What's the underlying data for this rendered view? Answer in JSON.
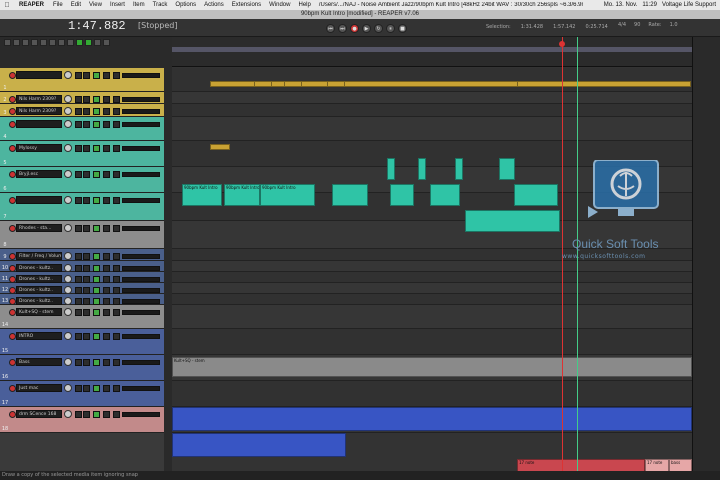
{
  "menubar": {
    "apple": "",
    "app": "REAPER",
    "items": [
      "File",
      "Edit",
      "View",
      "Insert",
      "Item",
      "Track",
      "Options",
      "Actions",
      "Extensions",
      "Window",
      "Help"
    ],
    "project_path": "/Users/.../NAJ - Noise Ambient Jazz/90bpm Kult Intro [48kHz 24bit WAV : 30/30ch 256spls ~6.3/6.9ms]",
    "date": "Mo. 13. Nov.",
    "time": "11:29",
    "user": "Voltage Life Support"
  },
  "window": {
    "title": "90bpm Kult Intro [modified] - REAPER v7.06"
  },
  "transport": {
    "position": "1:47.882",
    "state": "[Stopped]",
    "buttons": [
      "⏮",
      "⏭",
      "●",
      "▶",
      "↻",
      "⏸",
      "■"
    ],
    "selection_label": "Selection:",
    "sel_start": "1:31.428",
    "sel_end": "1:57.142",
    "sel_len": "0:25.714",
    "time_sig": "4/4",
    "bpm": "90",
    "rate_label": "Rate:",
    "rate": "1.0"
  },
  "tracks": [
    {
      "num": "1",
      "name": "",
      "color": "#c9b04a",
      "h": 24
    },
    {
      "num": "2",
      "name": "Nils Harm 2309?",
      "color": "#c9b04a",
      "h": 12
    },
    {
      "num": "3",
      "name": "Nils Harm 2309?",
      "color": "#c9b04a",
      "h": 13
    },
    {
      "num": "4",
      "name": "",
      "color": "#4db59f",
      "h": 24
    },
    {
      "num": "5",
      "name": "Mylossy",
      "color": "#4db59f",
      "h": 26
    },
    {
      "num": "6",
      "name": "Bryjl.esc",
      "color": "#4db59f",
      "h": 26
    },
    {
      "num": "7",
      "name": "",
      "color": "#4db59f",
      "h": 28
    },
    {
      "num": "8",
      "name": "Rhodes - sta...",
      "color": "#8d8d8d",
      "h": 28
    },
    {
      "num": "9",
      "name": "Filter / Freq / Volume 2",
      "color": "#4a5f8a",
      "h": 12
    },
    {
      "num": "10",
      "name": "Drones - kultz..",
      "color": "#4a5f8a",
      "h": 11
    },
    {
      "num": "11",
      "name": "Drones - kultz..",
      "color": "#4a5f8a",
      "h": 11
    },
    {
      "num": "12",
      "name": "Drones - kultz..",
      "color": "#4a5f8a",
      "h": 11
    },
    {
      "num": "13",
      "name": "Drones - kultz..",
      "color": "#4a5f8a",
      "h": 11
    },
    {
      "num": "14",
      "name": "Kult+SQ - stem",
      "color": "#8d8d8d",
      "h": 24
    },
    {
      "num": "15",
      "name": "INTRO",
      "color": "#4a5f9a",
      "h": 26
    },
    {
      "num": "16",
      "name": "Bass",
      "color": "#4a5f9a",
      "h": 26
    },
    {
      "num": "17",
      "name": "Just mac",
      "color": "#4a5f9a",
      "h": 26
    },
    {
      "num": "18",
      "name": "drm SCence 168",
      "color": "#c28a8a",
      "h": 26
    }
  ],
  "items": {
    "y1": "90bpm Kult Intro",
    "t1": "Kult+SQ - stem",
    "t2": "17 note",
    "t3": "17 note",
    "t4": "bass"
  },
  "watermark": {
    "title": "Quick Soft Tools",
    "url": "www.quicksofttools.com"
  },
  "status": "Draw a copy of the selected media item ignoring snap"
}
